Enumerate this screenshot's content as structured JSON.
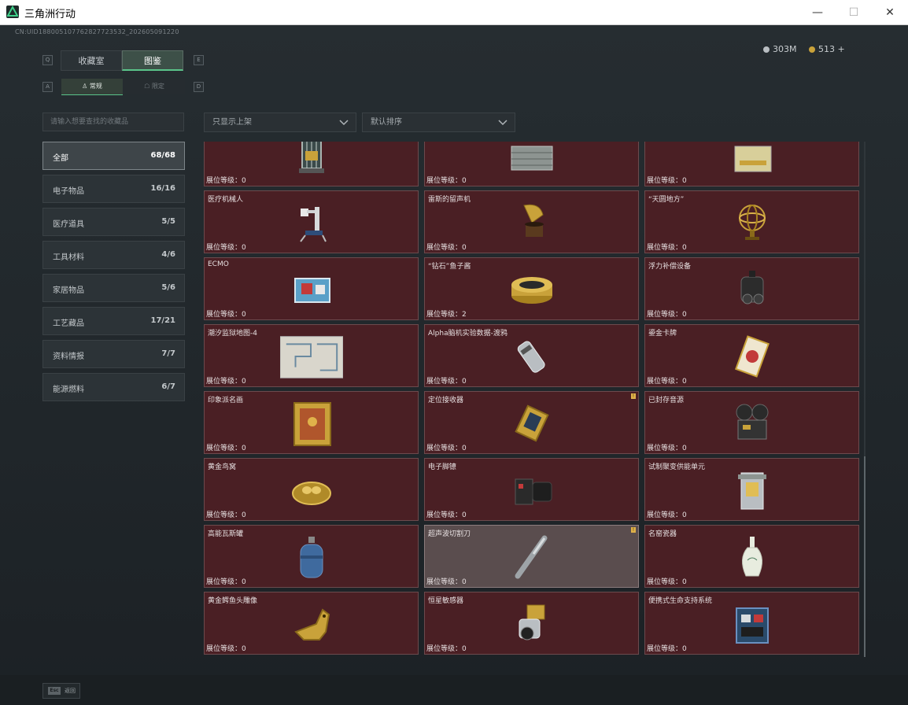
{
  "window": {
    "title": "三角洲行动",
    "min": "—",
    "max": "☐",
    "close": "✕"
  },
  "uid": "CN:UID188005107762827723532_202605091220",
  "currency": {
    "money": "303M",
    "coins": "513 +"
  },
  "tabs": [
    {
      "label": "收藏室",
      "key": "Q"
    },
    {
      "label": "图鉴",
      "key": "E"
    }
  ],
  "subtabs": [
    {
      "label": "常规",
      "key": "A"
    },
    {
      "label": "限定",
      "key": "D"
    }
  ],
  "search": {
    "placeholder": "请输入想要查找的收藏品"
  },
  "filters": {
    "shelf": "只显示上架",
    "sort": "默认排序"
  },
  "categories": [
    {
      "label": "全部",
      "count": "68/68"
    },
    {
      "label": "电子物品",
      "count": "16/16"
    },
    {
      "label": "医疗道具",
      "count": "5/5"
    },
    {
      "label": "工具材料",
      "count": "4/6"
    },
    {
      "label": "家居物品",
      "count": "5/6"
    },
    {
      "label": "工艺藏品",
      "count": "17/21"
    },
    {
      "label": "资料情报",
      "count": "7/7"
    },
    {
      "label": "能源燃料",
      "count": "6/7"
    }
  ],
  "level_prefix": "展位等级：",
  "items": [
    {
      "name": "",
      "level": "0",
      "icon": "cage-icon"
    },
    {
      "name": "",
      "level": "0",
      "icon": "server-icon"
    },
    {
      "name": "",
      "level": "0",
      "icon": "battery-icon"
    },
    {
      "name": "医疗机械人",
      "level": "0",
      "icon": "medical-robot-icon"
    },
    {
      "name": "雷斯的留声机",
      "level": "0",
      "icon": "gramophone-icon"
    },
    {
      "name": "“天圆地方”",
      "level": "0",
      "icon": "armillary-icon"
    },
    {
      "name": "ECMO",
      "level": "0",
      "icon": "ecmo-icon"
    },
    {
      "name": "“钻石”鱼子酱",
      "level": "2",
      "icon": "caviar-icon"
    },
    {
      "name": "浮力补偿设备",
      "level": "0",
      "icon": "buoyancy-icon"
    },
    {
      "name": "潮汐监狱地图-4",
      "level": "0",
      "icon": "map-icon"
    },
    {
      "name": "Alpha脑机实验数据-渡鸦",
      "level": "0",
      "icon": "data-device-icon"
    },
    {
      "name": "鎏金卡牌",
      "level": "0",
      "icon": "card-icon"
    },
    {
      "name": "印象派名画",
      "level": "0",
      "icon": "painting-icon"
    },
    {
      "name": "定位接收器",
      "level": "0",
      "icon": "receiver-icon"
    },
    {
      "name": "已封存音源",
      "level": "0",
      "icon": "projector-icon"
    },
    {
      "name": "黄金鸟窝",
      "level": "0",
      "icon": "nest-icon"
    },
    {
      "name": "电子脚镣",
      "level": "0",
      "icon": "anklet-icon"
    },
    {
      "name": "试制聚变供能单元",
      "level": "0",
      "icon": "fusion-icon"
    },
    {
      "name": "高能瓦斯罐",
      "level": "0",
      "icon": "gas-tank-icon"
    },
    {
      "name": "超声波切割刀",
      "level": "0",
      "icon": "cutter-icon"
    },
    {
      "name": "名窑瓷器",
      "level": "0",
      "icon": "vase-icon"
    },
    {
      "name": "黄金鳄鱼头雕像",
      "level": "0",
      "icon": "croc-statue-icon"
    },
    {
      "name": "恒星敏感器",
      "level": "0",
      "icon": "star-sensor-icon"
    },
    {
      "name": "便携式生命支持系统",
      "level": "0",
      "icon": "life-support-icon"
    }
  ],
  "footer": {
    "key": "Esc",
    "label": "返回"
  },
  "colors": {
    "card_bg": "#4a1f24",
    "accent": "#5ac48a",
    "gold": "#c9a23a"
  }
}
